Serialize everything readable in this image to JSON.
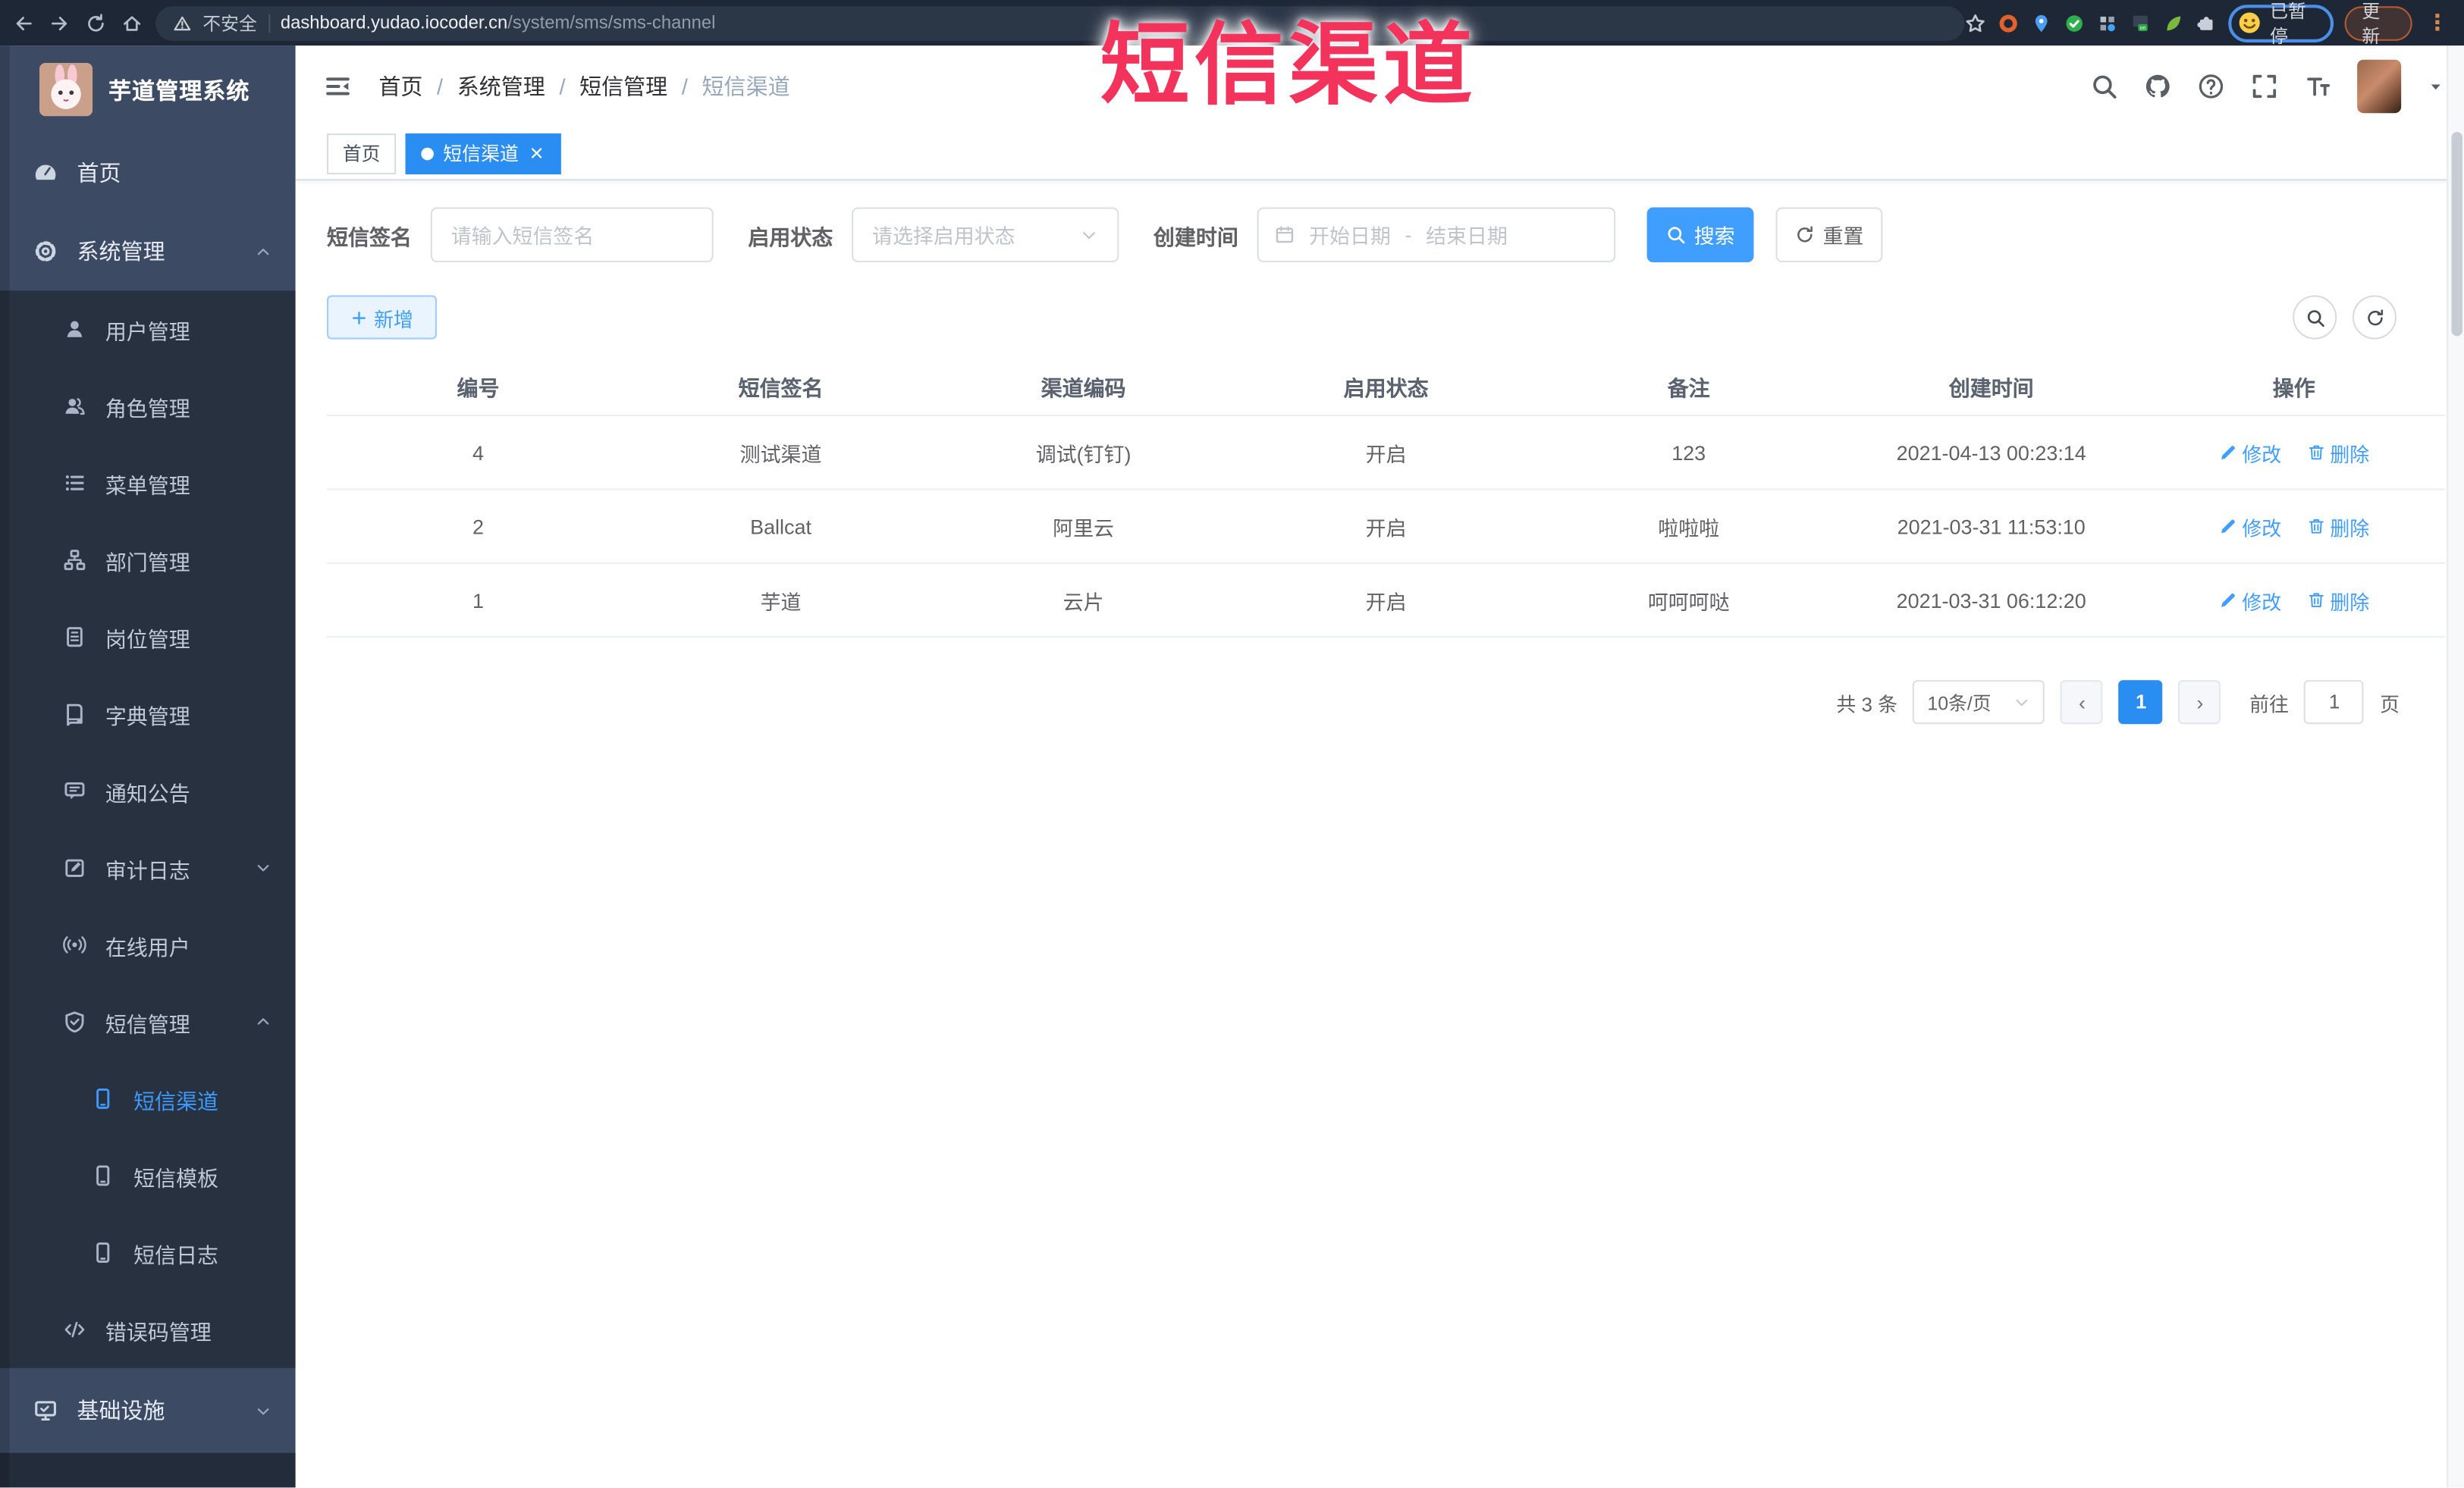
{
  "browser": {
    "security_label": "不安全",
    "url_host": "dashboard.yudao.iocoder.cn",
    "url_path": "/system/sms/sms-channel",
    "nav_icons": [
      "back-icon",
      "forward-icon",
      "reload-icon",
      "home-icon"
    ],
    "extension_icons": [
      "ext-orange-ring-icon",
      "ext-blue-pin-icon",
      "ext-green-check-icon",
      "ext-grid-icon",
      "ext-proxy-icon",
      "ext-leaf-icon",
      "ext-puzzle-icon"
    ],
    "paused_label": "已暂停",
    "update_label": "更新",
    "menu_dots": "⋮"
  },
  "overlay_title": "短信渠道",
  "colors": {
    "accent": "#409eff",
    "tab_active": "#2a8df2",
    "overlay_red": "#f3335c",
    "sidebar_bg": "#3c4a64",
    "sidebar_submenu_bg": "#283140"
  },
  "sidebar": {
    "logo_title": "芋道管理系统",
    "menu": [
      {
        "id": "home",
        "label": "首页",
        "icon": "dashboard-icon",
        "level": 1,
        "section": "top"
      },
      {
        "id": "system",
        "label": "系统管理",
        "icon": "gear-icon",
        "level": 1,
        "chevron": "up",
        "section": "top"
      },
      {
        "id": "user",
        "label": "用户管理",
        "icon": "user-icon",
        "level": 2
      },
      {
        "id": "role",
        "label": "角色管理",
        "icon": "users-icon",
        "level": 2
      },
      {
        "id": "menu",
        "label": "菜单管理",
        "icon": "menu-list-icon",
        "level": 2
      },
      {
        "id": "dept",
        "label": "部门管理",
        "icon": "org-tree-icon",
        "level": 2
      },
      {
        "id": "post",
        "label": "岗位管理",
        "icon": "badge-icon",
        "level": 2
      },
      {
        "id": "dict",
        "label": "字典管理",
        "icon": "dict-icon",
        "level": 2
      },
      {
        "id": "notice",
        "label": "通知公告",
        "icon": "announcement-icon",
        "level": 2
      },
      {
        "id": "audit",
        "label": "审计日志",
        "icon": "audit-log-icon",
        "level": 2,
        "chevron": "down"
      },
      {
        "id": "online",
        "label": "在线用户",
        "icon": "online-icon",
        "level": 2
      },
      {
        "id": "sms",
        "label": "短信管理",
        "icon": "sms-shield-icon",
        "level": 2,
        "chevron": "up"
      },
      {
        "id": "sms-channel",
        "label": "短信渠道",
        "icon": "phone-icon",
        "level": 3,
        "active": true
      },
      {
        "id": "sms-template",
        "label": "短信模板",
        "icon": "phone-icon",
        "level": 3
      },
      {
        "id": "sms-log",
        "label": "短信日志",
        "icon": "phone-icon",
        "level": 3
      },
      {
        "id": "errcode",
        "label": "错误码管理",
        "icon": "code-icon",
        "level": 2
      },
      {
        "id": "infra",
        "label": "基础设施",
        "icon": "infra-icon",
        "level": 1,
        "chevron": "down",
        "section": "bottom"
      }
    ]
  },
  "header": {
    "breadcrumb": [
      "首页",
      "系统管理",
      "短信管理",
      "短信渠道"
    ],
    "right_icons": [
      "search-icon",
      "github-icon",
      "question-icon",
      "fullscreen-icon",
      "font-size-icon"
    ]
  },
  "tabs": [
    {
      "label": "首页",
      "active": false
    },
    {
      "label": "短信渠道",
      "active": true,
      "closable": true
    }
  ],
  "filters": {
    "sign_label": "短信签名",
    "sign_placeholder": "请输入短信签名",
    "status_label": "启用状态",
    "status_placeholder": "请选择启用状态",
    "time_label": "创建时间",
    "start_placeholder": "开始日期",
    "range_separator": "-",
    "end_placeholder": "结束日期",
    "search_label": "搜索",
    "reset_label": "重置"
  },
  "toolbar": {
    "add_label": "新增"
  },
  "table": {
    "headers": [
      "编号",
      "短信签名",
      "渠道编码",
      "启用状态",
      "备注",
      "创建时间",
      "操作"
    ],
    "rows": [
      [
        "4",
        "测试渠道",
        "调试(钉钉)",
        "开启",
        "123",
        "2021-04-13 00:23:14"
      ],
      [
        "2",
        "Ballcat",
        "阿里云",
        "开启",
        "啦啦啦",
        "2021-03-31 11:53:10"
      ],
      [
        "1",
        "芋道",
        "云片",
        "开启",
        "呵呵呵哒",
        "2021-03-31 06:12:20"
      ]
    ],
    "edit_label": "修改",
    "delete_label": "删除"
  },
  "pagination": {
    "total_label": "共 3 条",
    "page_size": "10条/页",
    "prev": "‹",
    "next": "›",
    "current_page": "1",
    "goto_label": "前往",
    "goto_value": "1",
    "page_unit": "页"
  }
}
